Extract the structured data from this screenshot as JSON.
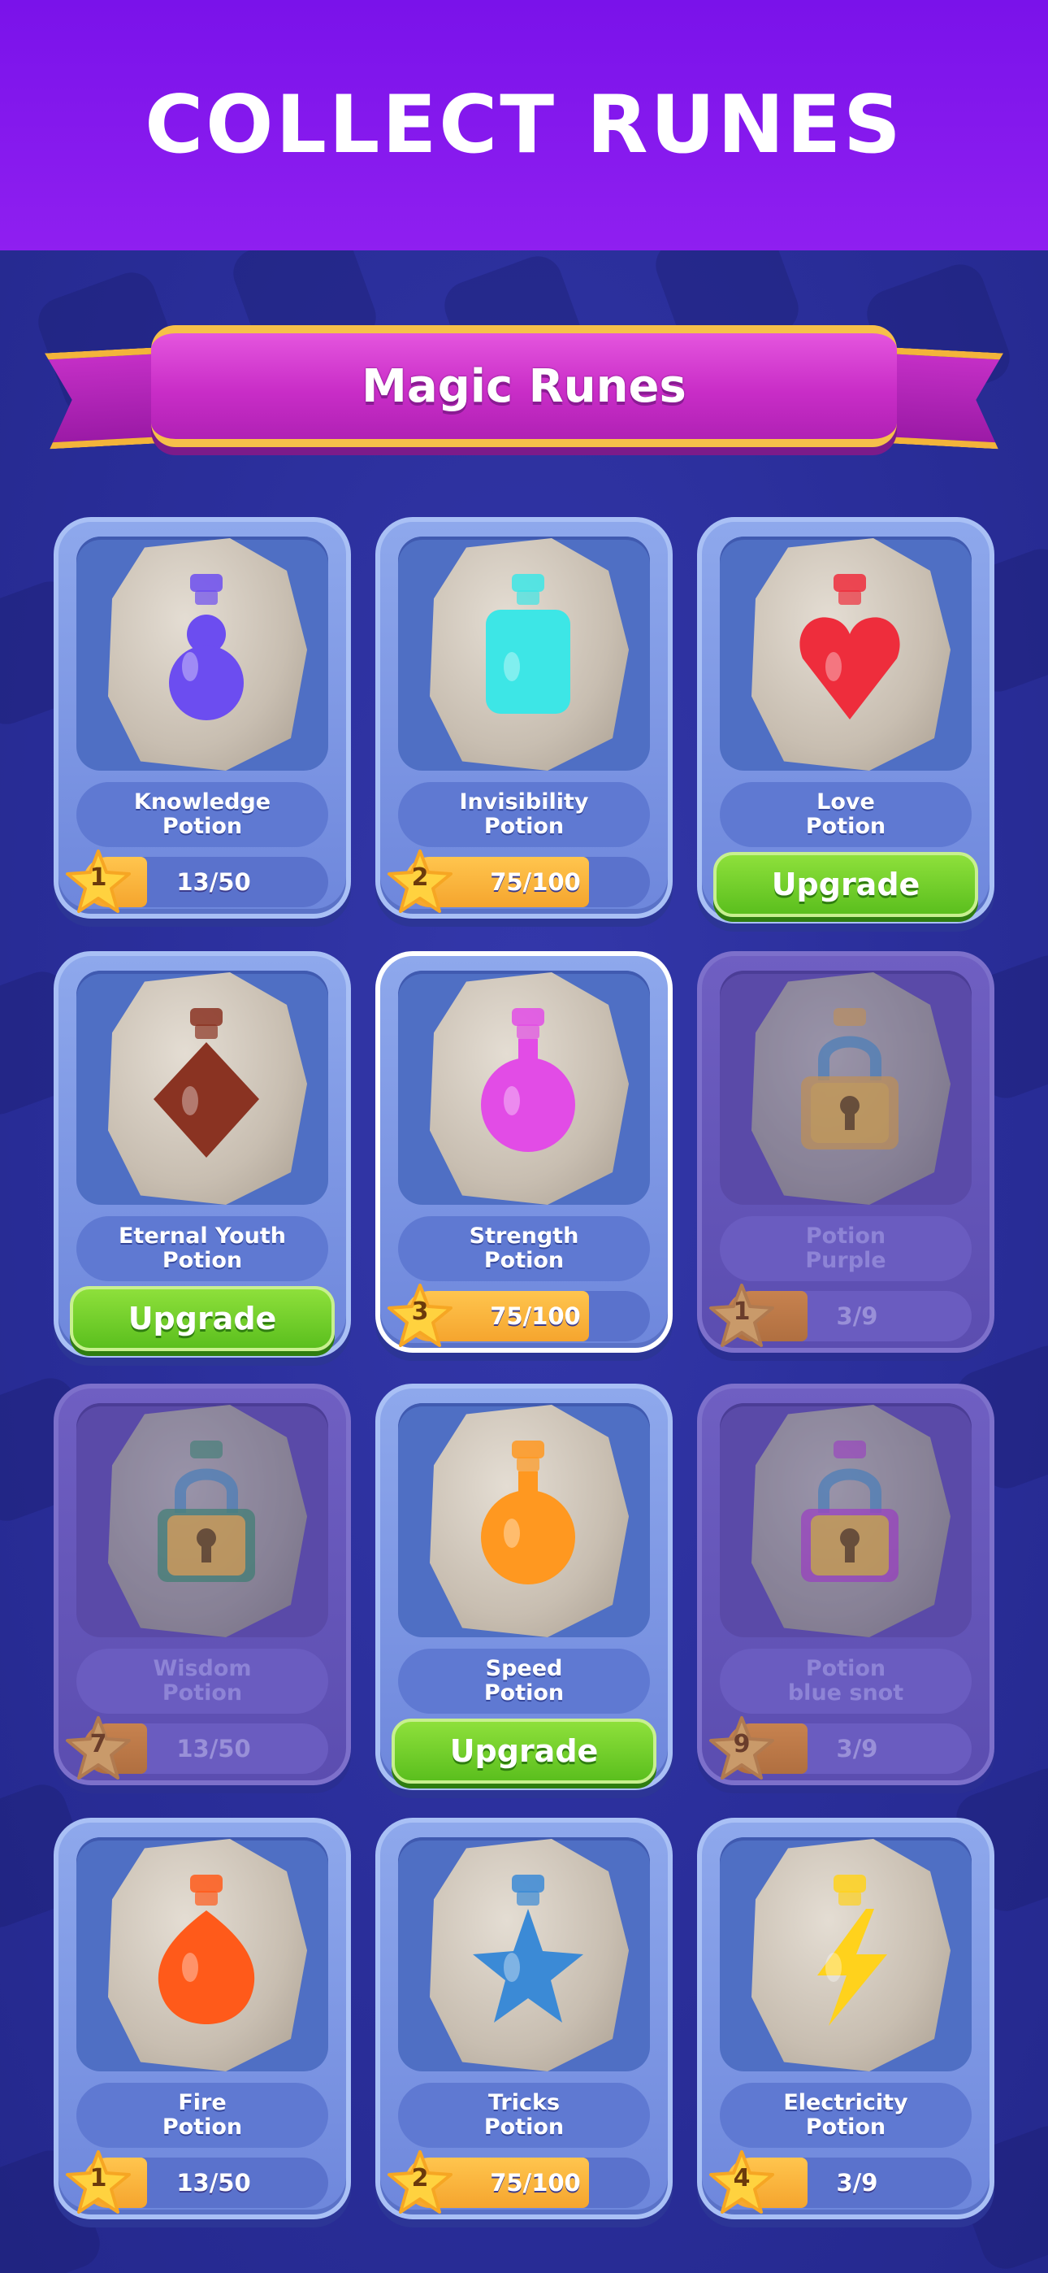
{
  "header": {
    "title": "COLLECT RUNES"
  },
  "banner": {
    "title": "Magic Runes"
  },
  "colors": {
    "header": "#7a12ea",
    "background": "#2b2f9e",
    "ribbon": "#c92dc7",
    "upgrade": "#5bbf1e",
    "progress_fill": "#f5a52e"
  },
  "cards": [
    {
      "name_line1": "Knowledge",
      "name_line2": "Potion",
      "level": "1",
      "progress_text": "13/50",
      "progress": 0.26,
      "state": "progress",
      "potion_color": "#6c4df0",
      "icon": "gourd-potion-icon"
    },
    {
      "name_line1": "Invisibility",
      "name_line2": "Potion",
      "level": "2",
      "progress_text": "75/100",
      "progress": 0.75,
      "state": "progress",
      "potion_color": "#3de6e6",
      "icon": "square-potion-icon"
    },
    {
      "name_line1": "Love",
      "name_line2": "Potion",
      "state": "upgrade",
      "button_label": "Upgrade",
      "potion_color": "#ee2d3c",
      "icon": "heart-potion-icon"
    },
    {
      "name_line1": "Eternal Youth",
      "name_line2": "Potion",
      "state": "upgrade",
      "button_label": "Upgrade",
      "potion_color": "#8a3322",
      "icon": "diamond-potion-icon"
    },
    {
      "name_line1": "Strength",
      "name_line2": "Potion",
      "level": "3",
      "progress_text": "75/100",
      "progress": 0.75,
      "state": "progress",
      "selected": true,
      "potion_color": "#e24ce6",
      "icon": "round-potion-icon"
    },
    {
      "name_line1": "Potion",
      "name_line2": "Purple",
      "level": "1",
      "progress_text": "3/9",
      "progress": 0.33,
      "state": "locked",
      "potion_color": "#c79048",
      "icon": "lock-icon"
    },
    {
      "name_line1": "Wisdom",
      "name_line2": "Potion",
      "level": "7",
      "progress_text": "13/50",
      "progress": 0.26,
      "state": "locked",
      "potion_color": "#2f7c6c",
      "icon": "lock-icon"
    },
    {
      "name_line1": "Speed",
      "name_line2": "Potion",
      "state": "upgrade",
      "button_label": "Upgrade",
      "potion_color": "#ff9820",
      "icon": "round-potion-icon"
    },
    {
      "name_line1": "Potion",
      "name_line2": "blue snot",
      "level": "9",
      "progress_text": "3/9",
      "progress": 0.33,
      "state": "locked",
      "potion_color": "#9b2fc8",
      "icon": "lock-icon"
    },
    {
      "name_line1": "Fire",
      "name_line2": "Potion",
      "level": "1",
      "progress_text": "13/50",
      "progress": 0.26,
      "state": "progress",
      "potion_color": "#ff5a1a",
      "icon": "flame-potion-icon"
    },
    {
      "name_line1": "Tricks",
      "name_line2": "Potion",
      "level": "2",
      "progress_text": "75/100",
      "progress": 0.75,
      "state": "progress",
      "potion_color": "#3b8ad6",
      "icon": "star-potion-icon"
    },
    {
      "name_line1": "Electricity",
      "name_line2": "Potion",
      "level": "4",
      "progress_text": "3/9",
      "progress": 0.33,
      "state": "progress",
      "potion_color": "#ffd21c",
      "icon": "bolt-potion-icon"
    }
  ]
}
